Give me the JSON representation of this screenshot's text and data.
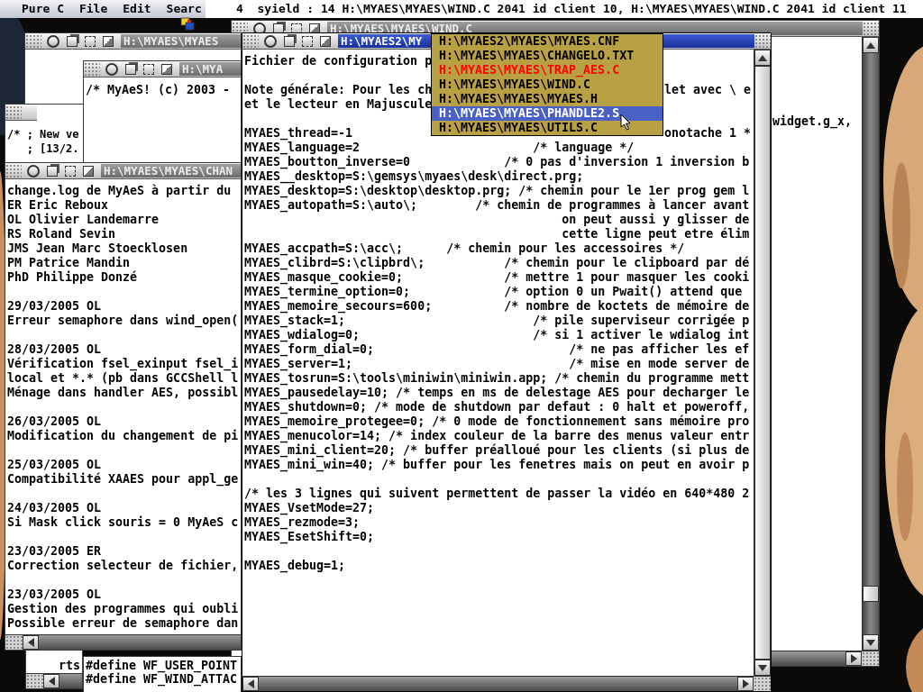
{
  "menu_bar": {
    "items": [
      "Pure C",
      "File",
      "Edit",
      "Searc"
    ],
    "status": "4  syield : 14 H:\\MYAES\\MYAES\\WIND.C 2041 id client 10, H:\\MYAES\\MYAES\\WIND.C 2041 id client 11"
  },
  "windows": [
    {
      "title": "H:\\MYAES\\MYAES\\WIND.C",
      "active": false,
      "blocks": [
        [
          "widget.g_x,"
        ]
      ]
    },
    {
      "title": "H:\\MYAES\\MYAES",
      "active": false
    },
    {
      "title": "H:\\MYAES2\\MY",
      "active": true,
      "blocks": [
        [
          "Fichier de configuration p"
        ],
        [
          {
            "text": "Note générale: Pour les ch",
            "right": "let avec \\ e"
          },
          "et le lecteur en Majuscule"
        ],
        [
          {
            "text": "MYAES_thread=-1",
            "right": "onotache 1 *"
          },
          "MYAES_language=2                        /* language */",
          "MYAES_boutton_inverse=0             /* 0 pas d'inversion 1 inversion b",
          "MYAES__desktop=S:\\gemsys\\myaes\\desk\\direct.prg;",
          "MYAES_desktop=S:\\desktop\\desktop.prg; /* chemin pour le 1er prog gem l",
          "MYAES_autopath=S:\\auto\\;        /* chemin de programmes à lancer avant",
          "                                            on peut aussi y glisser de",
          "                                            cette ligne peut etre élim",
          "MYAES_accpath=S:\\acc\\;      /* chemin pour les accessoires */",
          "MYAES_clibrd=S:\\clipbrd\\;           /* chemin pour le clipboard par dé",
          "MYAES_masque_cookie=0;              /* mettre 1 pour masquer les cooki",
          "MYAES_termine_option=0;             /* option 0 un Pwait() attend que",
          "MYAES_memoire_secours=600;          /* nombre de koctets de mémoire de",
          "MYAES_stack=1;                          /* pile superviseur corrigée p",
          "MYAES_wdialog=0;                        /* si 1 activer le wdialog int",
          "MYAES_form_dial=0;                           /* ne pas afficher les ef",
          "MYAES_server=1;                              /* mise en mode server de",
          "MYAES_tosrun=S:\\tools\\miniwin\\miniwin.app; /* chemin du programme mett",
          "MYAES_pausedelay=10; /* temps en ms de delestage AES pour decharger le",
          "MYAES_shutdown=0; /* mode de shutdown par defaut : 0 halt et poweroff,",
          "MYAES_memoire_protegee=0; /* 0 mode de fonctionnement sans mémoire pro",
          "MYAES_menucolor=14; /* index couleur de la barre des menus valeur entr",
          "MYAES_mini_client=20; /* buffer préalloué pour les clients (si plus de",
          "MYAES_mini_win=40; /* buffer pour les fenetres mais on peut en avoir p"
        ],
        [
          "/* les 3 lignes qui suivent permettent de passer la vidéo en 640*480 2",
          "MYAES_VsetMode=27;",
          "MYAES_rezmode=3;",
          "MYAES_EsetShift=0;"
        ],
        [
          "MYAES_debug=1;"
        ]
      ]
    },
    {
      "title": "H:\\MYA",
      "active": false,
      "blocks": [
        [
          "/* MyAeS! (c) 2003 -"
        ]
      ]
    },
    {
      "active": false,
      "blocks": [
        [
          "/* ; New ve",
          "   ; [13/2."
        ]
      ]
    },
    {
      "title": "H:\\MYAES\\MYAES\\CHAN",
      "active": false,
      "blocks": [
        [
          "change.log de MyAeS à partir du",
          "ER Eric Reboux",
          "OL Olivier Landemarre",
          "RS Roland Sevin",
          "JMS Jean Marc Stoecklosen",
          "PM Patrice Mandin",
          "PhD Philippe Donzé"
        ],
        [
          "29/03/2005 OL",
          "Erreur semaphore dans wind_open("
        ],
        [
          "28/03/2005 OL",
          "Vérification fsel_exinput fsel_i",
          "local et *.* (pb dans GCCShell l",
          "Ménage dans handler AES, possibl"
        ],
        [
          "26/03/2005 OL",
          "Modification du changement de pi"
        ],
        [
          "25/03/2005 OL",
          "Compatibilité XAAES pour appl_ge"
        ],
        [
          "24/03/2005 OL",
          "Si Mask click souris = 0 MyAeS c"
        ],
        [
          "23/03/2005 ER",
          "Correction selecteur de fichier,"
        ],
        [
          "23/03/2005 OL",
          "Gestion des programmes qui oubli",
          "Possible erreur de semaphore dan"
        ]
      ]
    },
    {
      "active": false,
      "blocks": [
        [
          "rts"
        ]
      ]
    },
    {
      "active": false,
      "blocks": [
        [
          "#define WF_USER_POINT",
          "#define WF_WIND_ATTAC"
        ]
      ]
    }
  ],
  "popup": {
    "items": [
      {
        "text": "H:\\MYAES2\\MYAES\\MYAES.CNF",
        "kind": "plain",
        "selected": false
      },
      {
        "text": "H:\\MYAES\\MYAES\\CHANGELO.TXT",
        "kind": "plain",
        "selected": false
      },
      {
        "text": "H:\\MYAES\\MYAES\\TRAP_AES.C",
        "kind": "error",
        "selected": false
      },
      {
        "text": "H:\\MYAES\\MYAES\\WIND.C",
        "kind": "plain",
        "selected": false
      },
      {
        "text": "H:\\MYAES\\MYAES\\MYAES.H",
        "kind": "plain",
        "selected": false
      },
      {
        "text": "H:\\MYAES\\MYAES\\PHANDLE2.S",
        "kind": "plain",
        "selected": true
      },
      {
        "text": "H:\\MYAES\\MYAES\\UTILS.C",
        "kind": "plain",
        "selected": false
      }
    ]
  }
}
